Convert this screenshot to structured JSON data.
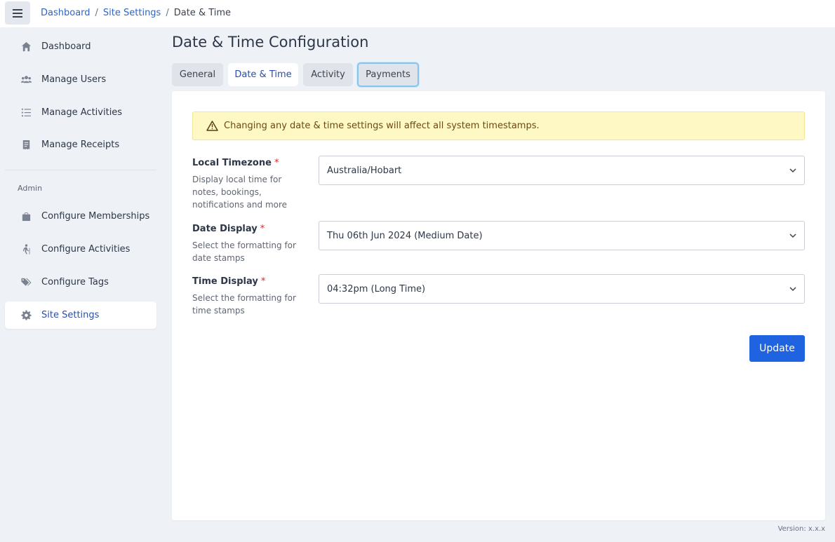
{
  "topbar": {
    "breadcrumb": [
      "Dashboard",
      "Site Settings",
      "Date & Time"
    ],
    "separator": "/"
  },
  "sidebar": {
    "items": [
      {
        "label": "Dashboard",
        "icon": "home-icon"
      },
      {
        "label": "Manage Users",
        "icon": "users-icon"
      },
      {
        "label": "Manage Activities",
        "icon": "list-icon"
      },
      {
        "label": "Manage Receipts",
        "icon": "receipt-icon"
      }
    ],
    "section_label": "Admin",
    "admin_items": [
      {
        "label": "Configure Memberships",
        "icon": "bag-icon"
      },
      {
        "label": "Configure Activities",
        "icon": "hiking-icon"
      },
      {
        "label": "Configure Tags",
        "icon": "tags-icon"
      },
      {
        "label": "Site Settings",
        "icon": "gear-icon",
        "active": true
      }
    ]
  },
  "page": {
    "title": "Date & Time Configuration",
    "tabs": [
      {
        "label": "General"
      },
      {
        "label": "Date & Time",
        "active": true
      },
      {
        "label": "Activity"
      },
      {
        "label": "Payments",
        "focused": true
      }
    ]
  },
  "alert": {
    "text": "Changing any date & time settings will affect all system timestamps.",
    "icon": "warning-icon"
  },
  "form": {
    "required_mark": "*",
    "timezone": {
      "label": "Local Timezone",
      "help": "Display local time for notes, bookings, notifications and more",
      "value": "Australia/Hobart"
    },
    "date_display": {
      "label": "Date Display",
      "help": "Select the formatting for date stamps",
      "value": "Thu 06th Jun 2024 (Medium Date)"
    },
    "time_display": {
      "label": "Time Display",
      "help": "Select the formatting for time stamps",
      "value": "04:32pm (Long Time)"
    },
    "update_label": "Update"
  },
  "footer": {
    "version": "Version: x.x.x"
  },
  "colors": {
    "accent": "#1f63e0",
    "link": "#2b65c9",
    "alert_bg": "#fdf8c4",
    "required": "#e02424"
  }
}
